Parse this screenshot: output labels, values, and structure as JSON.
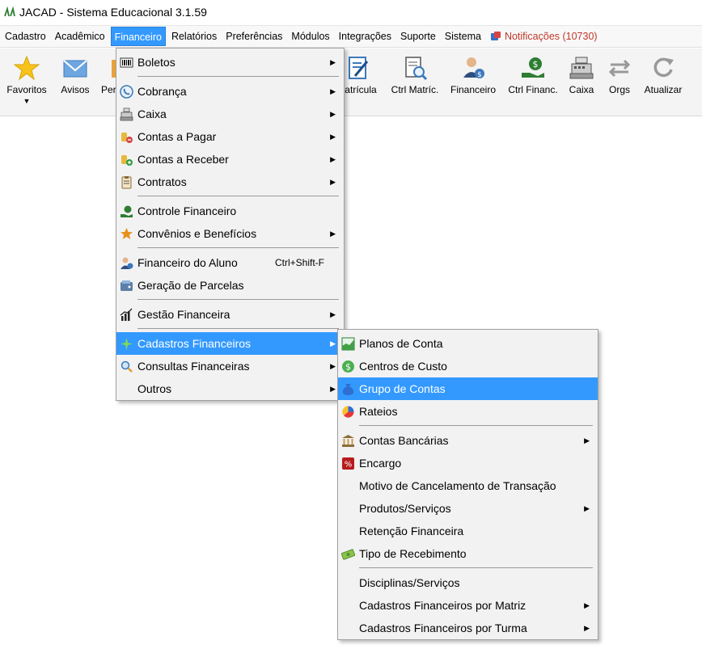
{
  "app": {
    "title": "JACAD - Sistema Educacional 3.1.59"
  },
  "menubar": {
    "items": [
      "Cadastro",
      "Acadêmico",
      "Financeiro",
      "Relatórios",
      "Preferências",
      "Módulos",
      "Integrações",
      "Suporte",
      "Sistema"
    ],
    "notification": "Notificações (10730)"
  },
  "toolbar": {
    "favoritos": "Favoritos",
    "avisos": "Avisos",
    "pe": "Per",
    "matricula": "Matrícula",
    "ctrl_matric": "Ctrl Matríc.",
    "financeiro": "Financeiro",
    "ctrl_financ": "Ctrl Financ.",
    "caixa": "Caixa",
    "orgs": "Orgs",
    "atualizar": "Atualizar"
  },
  "financeiro_menu": {
    "boletos": "Boletos",
    "cobranca": "Cobrança",
    "caixa": "Caixa",
    "contas_pagar": "Contas a Pagar",
    "contas_receber": "Contas a Receber",
    "contratos": "Contratos",
    "controle_financeiro": "Controle Financeiro",
    "convenios": "Convênios e Benefícios",
    "financeiro_aluno": "Financeiro do Aluno",
    "financeiro_aluno_shortcut": "Ctrl+Shift-F",
    "geracao_parcelas": "Geração de Parcelas",
    "gestao_financeira": "Gestão Financeira",
    "cadastros_financeiros": "Cadastros Financeiros",
    "consultas_financeiras": "Consultas Financeiras",
    "outros": "Outros"
  },
  "cadastros_submenu": {
    "planos_conta": "Planos de Conta",
    "centros_custo": "Centros de Custo",
    "grupo_contas": "Grupo de Contas",
    "rateios": "Rateios",
    "contas_bancarias": "Contas Bancárias",
    "encargo": "Encargo",
    "motivo_cancelamento": "Motivo de Cancelamento de Transação",
    "produtos_servicos": "Produtos/Serviços",
    "retencao_financeira": "Retenção Financeira",
    "tipo_recebimento": "Tipo de Recebimento",
    "disciplinas_servicos": "Disciplinas/Serviços",
    "por_matriz": "Cadastros Financeiros por Matriz",
    "por_turma": "Cadastros Financeiros por Turma"
  },
  "colors": {
    "highlight": "#3399ff",
    "notification": "#c0392b",
    "accent_green": "#2e7d32"
  }
}
